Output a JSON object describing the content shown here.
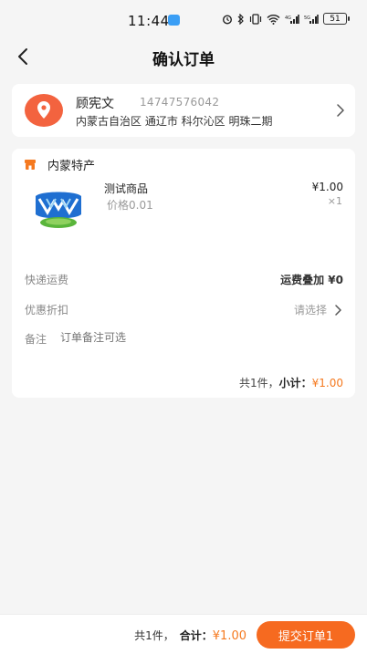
{
  "status_bar": {
    "time": "11:44",
    "signal_text": "⁴ᴳ",
    "battery": "51"
  },
  "nav": {
    "title": "确认订单"
  },
  "address": {
    "name": "顾宪文",
    "phone": "14747576042",
    "detail": "内蒙古自治区 通辽市 科尔沁区 明珠二期"
  },
  "order": {
    "shop_name": "内蒙特产",
    "product": {
      "name": "测试商品",
      "price_label": "价格0.01",
      "price": "¥1.00",
      "quantity": "×1"
    },
    "shipping": {
      "label": "快递运费",
      "value": "运费叠加 ¥0"
    },
    "discount": {
      "label": "优惠折扣",
      "value": "请选择"
    },
    "remark": {
      "label": "备注",
      "placeholder": "订单备注可选"
    },
    "subtotal": {
      "count": "共1件，",
      "label": "小计：",
      "value": "¥1.00"
    }
  },
  "bottom_bar": {
    "count": "共1件，",
    "total_label": "合计：",
    "total_value": "¥1.00",
    "submit_label": "提交订单1"
  },
  "colors": {
    "accent": "#f66a20",
    "price": "#f5791f",
    "background": "#f5f5f5"
  }
}
